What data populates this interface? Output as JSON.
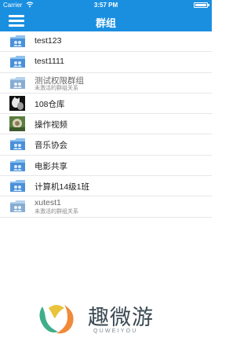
{
  "status_bar": {
    "carrier": "Carrier",
    "wifi_icon": "wifi-icon",
    "time": "3:57 PM",
    "battery_icon": "battery-icon"
  },
  "nav_bar": {
    "title": "群组",
    "menu_icon": "menu-icon"
  },
  "groups": [
    {
      "name": "test123",
      "subtitle": "",
      "icon": "folder-icon"
    },
    {
      "name": "test1111",
      "subtitle": "",
      "icon": "folder-icon"
    },
    {
      "name": "测试权限群组",
      "subtitle": "未激活的群组关系",
      "icon": "folder-icon"
    },
    {
      "name": "108仓库",
      "subtitle": "",
      "icon": "avatar-image"
    },
    {
      "name": "操作视频",
      "subtitle": "",
      "icon": "avatar-image"
    },
    {
      "name": "音乐协会",
      "subtitle": "",
      "icon": "folder-icon"
    },
    {
      "name": "电影共享",
      "subtitle": "",
      "icon": "folder-icon"
    },
    {
      "name": "计算机14级1班",
      "subtitle": "",
      "icon": "folder-icon"
    },
    {
      "name": "xutest1",
      "subtitle": "未激活的群组关系",
      "icon": "folder-icon"
    }
  ],
  "watermark": {
    "text": "趣微游",
    "subtext": "QUWEIYOU",
    "icon": "watermark-logo-icon"
  },
  "colors": {
    "header_blue": "#1a8fe0",
    "folder_blue": "#4a90d9",
    "divider": "#e7e7e7"
  }
}
